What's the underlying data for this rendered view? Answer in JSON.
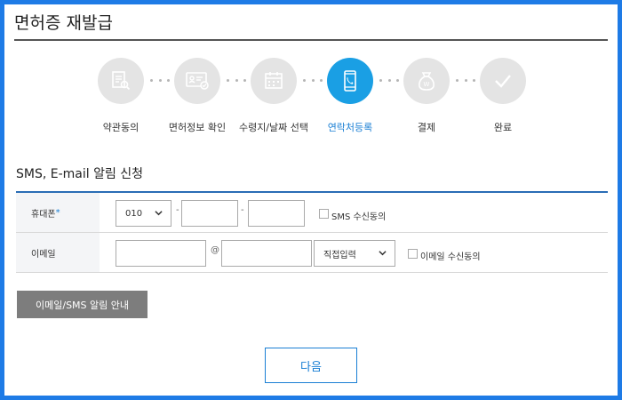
{
  "page": {
    "title": "면허증 재발급"
  },
  "steps": [
    {
      "label": "약관동의",
      "icon": "document-search-icon",
      "active": false
    },
    {
      "label": "면허정보 확인",
      "icon": "license-card-icon",
      "active": false
    },
    {
      "label": "수령지/날짜 선택",
      "icon": "calendar-icon",
      "active": false
    },
    {
      "label": "연락처등록",
      "icon": "mobile-phone-icon",
      "active": true
    },
    {
      "label": "결제",
      "icon": "money-bag-icon",
      "active": false
    },
    {
      "label": "완료",
      "icon": "checkmark-icon",
      "active": false
    }
  ],
  "section": {
    "title": "SMS, E-mail 알림 신청"
  },
  "form": {
    "phone": {
      "label": "휴대폰",
      "required_mark": "*",
      "prefix": "010",
      "separator": "-",
      "middle": "",
      "last": "",
      "consent_label": "SMS 수신동의"
    },
    "email": {
      "label": "이메일",
      "id": "",
      "at": "@",
      "domain": "",
      "domain_select": "직접입력",
      "consent_label": "이메일 수신동의"
    }
  },
  "buttons": {
    "info": "이메일/SMS 알림 안내",
    "next": "다음"
  },
  "colors": {
    "frame": "#1e7be6",
    "active_step": "#1a9fe4",
    "inactive_step": "#e4e4e4",
    "table_top_border": "#2a6db5",
    "info_button": "#7d7d7d",
    "next_button_border": "#1a7fd4"
  }
}
